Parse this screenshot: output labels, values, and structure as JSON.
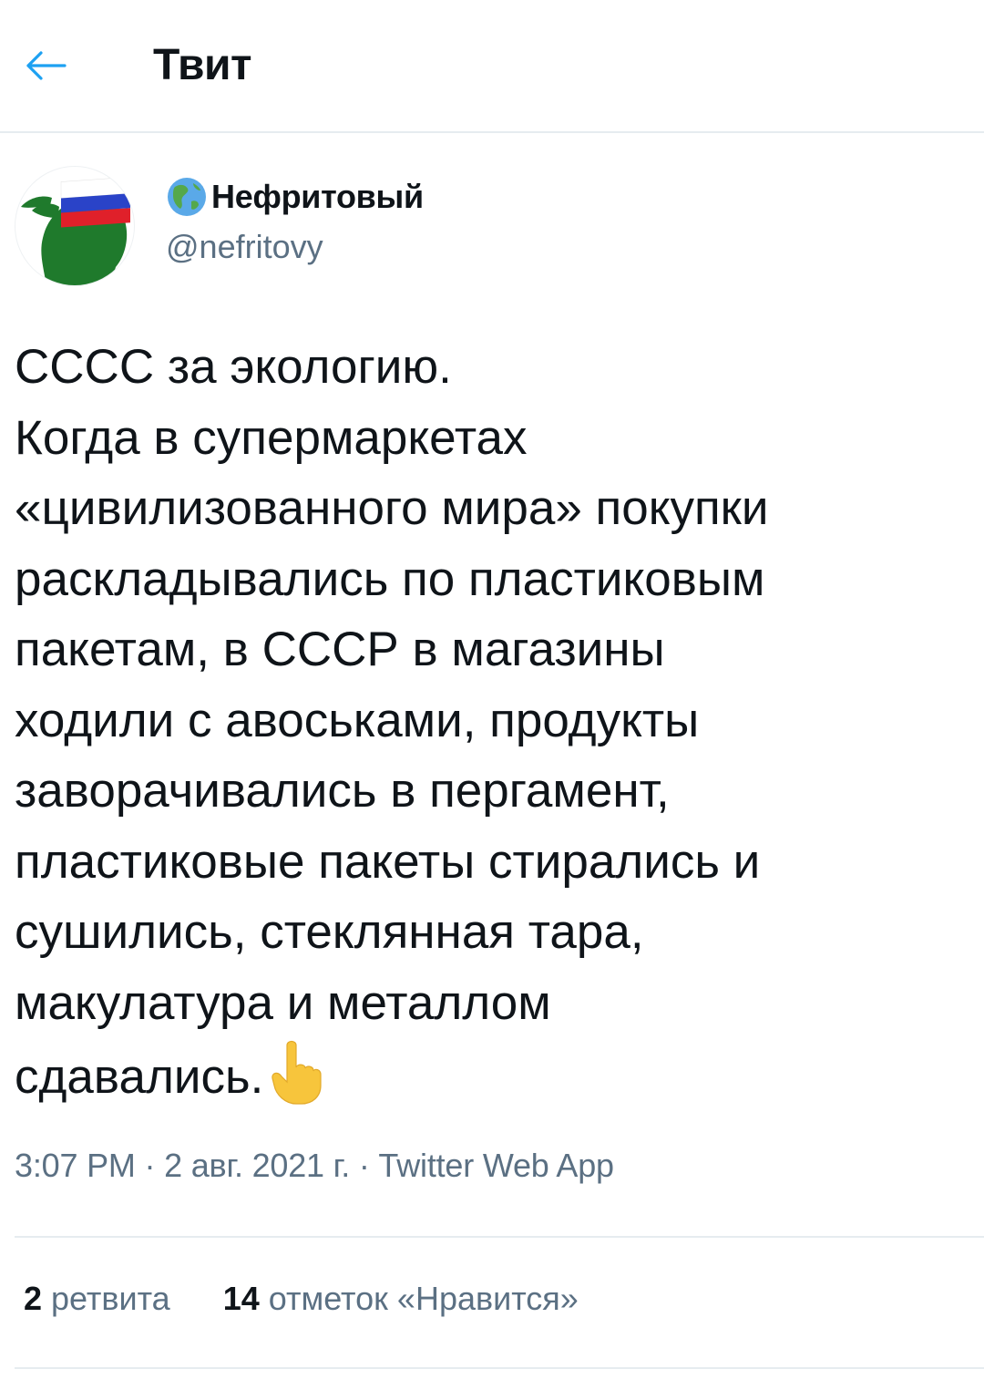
{
  "header": {
    "title": "Твит",
    "back_icon": "arrow-left-icon"
  },
  "author": {
    "display_name": "Нефритовый",
    "handle": "@nefritovy",
    "name_emoji": "globe-americas-icon"
  },
  "tweet": {
    "lines": [
      "СССС за экологию.",
      "Когда в супермаркетах",
      "«цивилизованного мира» покупки",
      "раскладывались по пластиковым",
      "пакетам, в СССР в магазины",
      "ходили с авоськами, продукты",
      "заворачивались в пергамент,",
      "пластиковые пакеты стирались и",
      "сушились, стеклянная тара,",
      "макулатура и металлом",
      "сдавались."
    ],
    "trailing_emoji": "pointing-up-hand-icon"
  },
  "meta": {
    "time": "3:07 PM",
    "date": "2 авг. 2021 г.",
    "source": "Twitter Web App",
    "separator": " · "
  },
  "stats": {
    "retweets_count": "2",
    "retweets_label": "ретвита",
    "likes_count": "14",
    "likes_label": "отметок «Нравится»"
  },
  "colors": {
    "accent": "#1da1f2",
    "text": "#0f1419",
    "secondary": "#5b7083",
    "divider": "#e6ecf0"
  }
}
